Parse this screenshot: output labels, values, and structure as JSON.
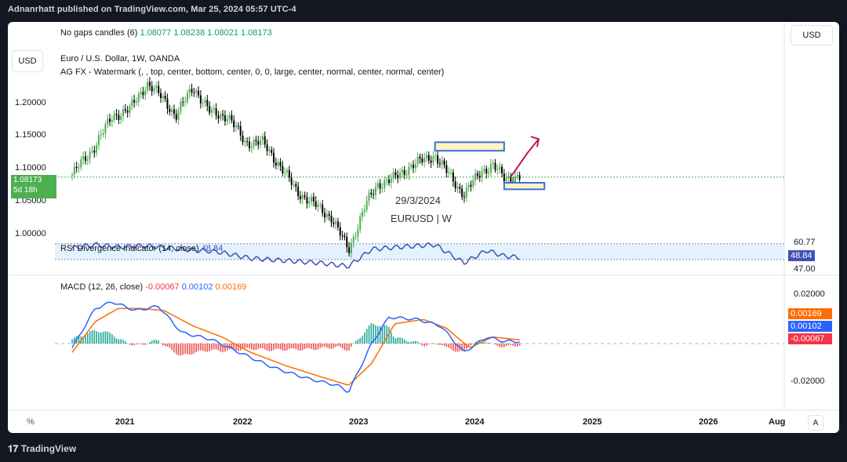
{
  "header": {
    "topbar": "Adnanrhatt published on TradingView.com, Mar 25, 2024 05:57 UTC-4",
    "gaps_label": "No gaps candles (6)",
    "gaps_values": [
      "1.08077",
      "1.08238",
      "1.08021",
      "1.08173"
    ],
    "symbol_line": "Euro / U.S. Dollar, 1W, OANDA",
    "watermark_line": "AG FX - Watermark (, , top, center, bottom, center, 0, 0, large, center, normal, center, normal, center)",
    "currency_button": "USD",
    "currency_left": "USD"
  },
  "price_axis": {
    "ticks": [
      "1.20000",
      "1.15000",
      "1.10000",
      "1.05000",
      "1.00000"
    ],
    "last_price": "1.08173",
    "countdown": "5d 18h"
  },
  "annotations": {
    "date_label": "29/3/2024",
    "pair_label": "EURUSD | W"
  },
  "rsi_indicator": {
    "label": "RSI Divergence Indicator (14, close)",
    "value": "48.84",
    "upper": "60.77",
    "lower": "47.00",
    "current": "48.84"
  },
  "macd_indicator": {
    "label": "MACD (12, 26, close)",
    "hist_value": "-0.00067",
    "macd_value": "0.00102",
    "signal_value": "0.00169",
    "axis_top": "0.02000",
    "axis_bottom": "-0.02000",
    "colors": {
      "macd": "#2962ff",
      "signal": "#ff6d00",
      "hist_neg": "#f23645",
      "hist_pos": "#089981"
    }
  },
  "time_axis": {
    "labels": [
      "2021",
      "2022",
      "2023",
      "2024",
      "2025",
      "2026",
      "Aug"
    ]
  },
  "footer": "TradingView",
  "chart_data": {
    "type": "candlestick",
    "timeframe": "1W",
    "symbol": "EURUSD",
    "price_series_approx": [
      [
        2020.35,
        1.085
      ],
      [
        2020.55,
        1.13
      ],
      [
        2020.7,
        1.175
      ],
      [
        2020.85,
        1.185
      ],
      [
        2021.0,
        1.225
      ],
      [
        2021.15,
        1.2
      ],
      [
        2021.25,
        1.175
      ],
      [
        2021.4,
        1.22
      ],
      [
        2021.55,
        1.18
      ],
      [
        2021.7,
        1.175
      ],
      [
        2021.85,
        1.135
      ],
      [
        2022.0,
        1.135
      ],
      [
        2022.15,
        1.1
      ],
      [
        2022.3,
        1.06
      ],
      [
        2022.45,
        1.04
      ],
      [
        2022.6,
        1.02
      ],
      [
        2022.75,
        0.97
      ],
      [
        2022.9,
        1.04
      ],
      [
        2023.0,
        1.07
      ],
      [
        2023.15,
        1.08
      ],
      [
        2023.3,
        1.1
      ],
      [
        2023.5,
        1.115
      ],
      [
        2023.6,
        1.09
      ],
      [
        2023.75,
        1.055
      ],
      [
        2023.9,
        1.09
      ],
      [
        2024.0,
        1.1
      ],
      [
        2024.1,
        1.08
      ],
      [
        2024.23,
        1.082
      ]
    ],
    "price_range": [
      0.995,
      1.235
    ],
    "rsi_series_approx": [
      [
        2020.35,
        57
      ],
      [
        2020.55,
        60
      ],
      [
        2020.75,
        58
      ],
      [
        2021.0,
        59
      ],
      [
        2021.3,
        56
      ],
      [
        2021.6,
        54
      ],
      [
        2021.9,
        48
      ],
      [
        2022.2,
        46
      ],
      [
        2022.5,
        44
      ],
      [
        2022.75,
        41
      ],
      [
        2022.95,
        56
      ],
      [
        2023.2,
        58
      ],
      [
        2023.5,
        60
      ],
      [
        2023.75,
        44
      ],
      [
        2023.95,
        55
      ],
      [
        2024.1,
        50
      ],
      [
        2024.23,
        48.84
      ]
    ],
    "rsi_levels": [
      60.77,
      47.0
    ],
    "macd_series_approx": [
      [
        2020.35,
        -0.002
      ],
      [
        2020.55,
        0.016
      ],
      [
        2020.7,
        0.019
      ],
      [
        2020.9,
        0.015
      ],
      [
        2021.1,
        0.017
      ],
      [
        2021.3,
        0.005
      ],
      [
        2021.55,
        0.002
      ],
      [
        2021.8,
        -0.004
      ],
      [
        2022.1,
        -0.011
      ],
      [
        2022.4,
        -0.016
      ],
      [
        2022.65,
        -0.019
      ],
      [
        2022.75,
        -0.022
      ],
      [
        2022.95,
        0.0
      ],
      [
        2023.1,
        0.012
      ],
      [
        2023.35,
        0.011
      ],
      [
        2023.55,
        0.008
      ],
      [
        2023.75,
        -0.004
      ],
      [
        2023.95,
        0.003
      ],
      [
        2024.1,
        0.001
      ],
      [
        2024.23,
        0.001
      ]
    ],
    "signal_series_approx": [
      [
        2020.35,
        -0.004
      ],
      [
        2020.55,
        0.01
      ],
      [
        2020.75,
        0.016
      ],
      [
        2020.95,
        0.016
      ],
      [
        2021.15,
        0.015
      ],
      [
        2021.4,
        0.008
      ],
      [
        2021.65,
        0.003
      ],
      [
        2021.9,
        -0.004
      ],
      [
        2022.2,
        -0.01
      ],
      [
        2022.5,
        -0.015
      ],
      [
        2022.75,
        -0.019
      ],
      [
        2022.95,
        -0.009
      ],
      [
        2023.15,
        0.009
      ],
      [
        2023.4,
        0.011
      ],
      [
        2023.6,
        0.007
      ],
      [
        2023.8,
        -0.002
      ],
      [
        2024.0,
        0.003
      ],
      [
        2024.23,
        0.0017
      ]
    ],
    "macd_range": [
      -0.025,
      0.025
    ],
    "x_range": [
      2020.2,
      2026.6
    ]
  }
}
